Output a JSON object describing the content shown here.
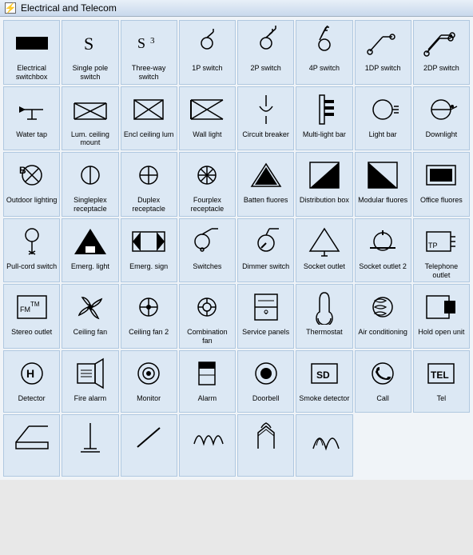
{
  "title": "Electrical and Telecom",
  "symbols": [
    {
      "label": "Electrical switchbox",
      "id": "electrical-switchbox"
    },
    {
      "label": "Single pole switch",
      "id": "single-pole-switch"
    },
    {
      "label": "Three-way switch",
      "id": "three-way-switch"
    },
    {
      "label": "1P switch",
      "id": "1p-switch"
    },
    {
      "label": "2P switch",
      "id": "2p-switch"
    },
    {
      "label": "4P switch",
      "id": "4p-switch"
    },
    {
      "label": "1DP switch",
      "id": "1dp-switch"
    },
    {
      "label": "2DP switch",
      "id": "2dp-switch"
    },
    {
      "label": "Water tap",
      "id": "water-tap"
    },
    {
      "label": "Lum. ceiling mount",
      "id": "lum-ceiling-mount"
    },
    {
      "label": "Encl ceiling lum",
      "id": "encl-ceiling-lum"
    },
    {
      "label": "Wall light",
      "id": "wall-light"
    },
    {
      "label": "Circuit breaker",
      "id": "circuit-breaker"
    },
    {
      "label": "Multi-light bar",
      "id": "multi-light-bar"
    },
    {
      "label": "Light bar",
      "id": "light-bar"
    },
    {
      "label": "Downlight",
      "id": "downlight"
    },
    {
      "label": "Outdoor lighting",
      "id": "outdoor-lighting"
    },
    {
      "label": "Singleplex receptacle",
      "id": "singleplex-receptacle"
    },
    {
      "label": "Duplex receptacle",
      "id": "duplex-receptacle"
    },
    {
      "label": "Fourplex receptacle",
      "id": "fourplex-receptacle"
    },
    {
      "label": "Batten fluores",
      "id": "batten-fluores"
    },
    {
      "label": "Distribution box",
      "id": "distribution-box"
    },
    {
      "label": "Modular fluores",
      "id": "modular-fluores"
    },
    {
      "label": "Office fluores",
      "id": "office-fluores"
    },
    {
      "label": "Pull-cord switch",
      "id": "pull-cord-switch"
    },
    {
      "label": "Emerg. light",
      "id": "emerg-light"
    },
    {
      "label": "Emerg. sign",
      "id": "emerg-sign"
    },
    {
      "label": "Switches",
      "id": "switches"
    },
    {
      "label": "Dimmer switch",
      "id": "dimmer-switch"
    },
    {
      "label": "Socket outlet",
      "id": "socket-outlet"
    },
    {
      "label": "Socket outlet 2",
      "id": "socket-outlet-2"
    },
    {
      "label": "Telephone outlet",
      "id": "telephone-outlet"
    },
    {
      "label": "Stereo outlet",
      "id": "stereo-outlet"
    },
    {
      "label": "Ceiling fan",
      "id": "ceiling-fan"
    },
    {
      "label": "Ceiling fan 2",
      "id": "ceiling-fan-2"
    },
    {
      "label": "Combination fan",
      "id": "combination-fan"
    },
    {
      "label": "Service panels",
      "id": "service-panels"
    },
    {
      "label": "Thermostat",
      "id": "thermostat"
    },
    {
      "label": "Air conditioning",
      "id": "air-conditioning"
    },
    {
      "label": "Hold open unit",
      "id": "hold-open-unit"
    },
    {
      "label": "Detector",
      "id": "detector"
    },
    {
      "label": "Fire alarm",
      "id": "fire-alarm"
    },
    {
      "label": "Monitor",
      "id": "monitor"
    },
    {
      "label": "Alarm",
      "id": "alarm"
    },
    {
      "label": "Doorbell",
      "id": "doorbell"
    },
    {
      "label": "Smoke detector",
      "id": "smoke-detector"
    },
    {
      "label": "Call",
      "id": "call"
    },
    {
      "label": "Tel",
      "id": "tel"
    },
    {
      "label": "",
      "id": "misc1"
    },
    {
      "label": "",
      "id": "misc2"
    },
    {
      "label": "",
      "id": "misc3"
    },
    {
      "label": "",
      "id": "misc4"
    },
    {
      "label": "",
      "id": "misc5"
    },
    {
      "label": "",
      "id": "misc6"
    },
    {
      "label": "",
      "id": "misc7"
    },
    {
      "label": "",
      "id": "misc8"
    }
  ]
}
